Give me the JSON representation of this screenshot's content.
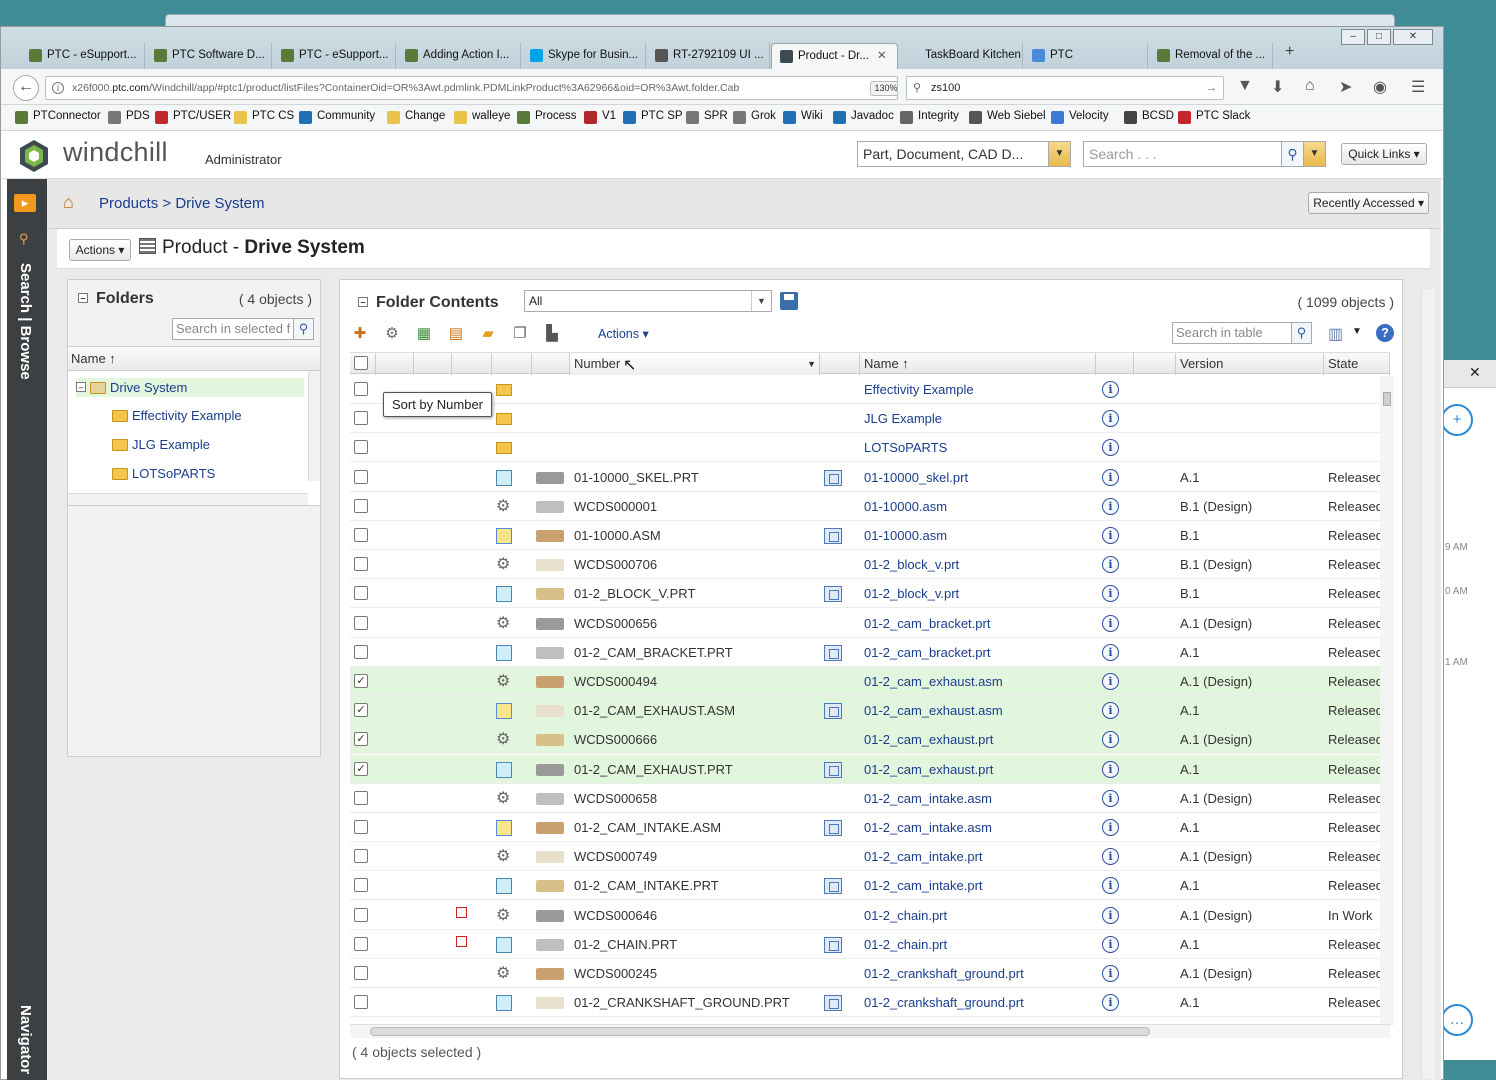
{
  "browser": {
    "tabs": [
      {
        "label": "PTC - eSupport...",
        "icon": "ptc-icon"
      },
      {
        "label": "PTC Software D...",
        "icon": "ptc-icon"
      },
      {
        "label": "PTC - eSupport...",
        "icon": "ptc-icon"
      },
      {
        "label": "Adding Action I...",
        "icon": "ptc-icon"
      },
      {
        "label": "Skype for Busin...",
        "icon": "skype-icon"
      },
      {
        "label": "RT-2792109 UI ...",
        "icon": "rt-icon"
      },
      {
        "label": "Product - Dr...",
        "icon": "windchill-icon"
      },
      {
        "label": "TaskBoard Kitchen ...",
        "icon": "none"
      },
      {
        "label": "PTC",
        "icon": "chrome-icon"
      },
      {
        "label": "Removal of the ...",
        "icon": "ptc-icon"
      }
    ],
    "new_tab": "+",
    "url_prefix": "x26f000.",
    "url_domain": "ptc.com",
    "url_rest": "/Windchill/app/#ptc1/product/listFiles?ContainerOid=OR%3Awt.pdmlink.PDMLinkProduct%3A62966&oid=OR%3Awt.folder.Cab",
    "zoom": "130%",
    "search_value": "zs100",
    "bookmarks": [
      "PTConnector",
      "PDS",
      "PTC/USER",
      "PTC CS",
      "Community",
      "Change",
      "walleye",
      "Process",
      "V1",
      "PTC SP",
      "SPR",
      "Grok",
      "Wiki",
      "Javadoc",
      "Integrity",
      "Web Siebel",
      "Velocity",
      "BCSD",
      "PTC Slack"
    ]
  },
  "header": {
    "app_name": "windchill",
    "user": "Administrator",
    "type_select": "Part, Document, CAD D...",
    "search_placeholder": "Search . . .",
    "quick_links": "Quick Links"
  },
  "left_nav": {
    "search_browse": "Search | Browse",
    "navigator": "Navigator"
  },
  "breadcrumb": {
    "products": "Products",
    "sep": ">",
    "current": "Drive System",
    "recently_accessed": "Recently Accessed"
  },
  "page": {
    "actions": "Actions",
    "title_prefix": "Product - ",
    "title_name": "Drive System"
  },
  "folders": {
    "title": "Folders",
    "count": "( 4 objects )",
    "search_placeholder": "Search in selected f",
    "col_name": "Name ↑",
    "tree": [
      {
        "label": "Drive System"
      },
      {
        "label": "Effectivity Example"
      },
      {
        "label": "JLG Example"
      },
      {
        "label": "LOTSoPARTS"
      }
    ]
  },
  "contents": {
    "title": "Folder Contents",
    "view": "All",
    "count": "( 1099 objects )",
    "actions": "Actions",
    "search_placeholder": "Search in table",
    "columns": {
      "number": "Number",
      "name": "Name ↑",
      "version": "Version",
      "state": "State"
    },
    "tooltip": "Sort by Number",
    "selected_count": "( 4 objects selected )",
    "rows": [
      {
        "type": "folder",
        "number": "",
        "name": "Effectivity Example",
        "version": "",
        "state": "",
        "checked": false
      },
      {
        "type": "folder",
        "number": "",
        "name": "JLG Example",
        "version": "",
        "state": "",
        "checked": false
      },
      {
        "type": "folder",
        "number": "",
        "name": "LOTSoPARTS",
        "version": "",
        "state": "",
        "checked": false
      },
      {
        "type": "cadpart",
        "number": "01-10000_SKEL.PRT",
        "name": "01-10000_skel.prt",
        "version": "A.1",
        "state": "Released",
        "checked": false
      },
      {
        "type": "part",
        "number": "WCDS000001",
        "name": "01-10000.asm",
        "version": "B.1 (Design)",
        "state": "Released",
        "checked": false
      },
      {
        "type": "cadasm",
        "number": "01-10000.ASM",
        "name": "01-10000.asm",
        "version": "B.1",
        "state": "Released",
        "checked": false
      },
      {
        "type": "part",
        "number": "WCDS000706",
        "name": "01-2_block_v.prt",
        "version": "B.1 (Design)",
        "state": "Released",
        "checked": false
      },
      {
        "type": "cadpart",
        "number": "01-2_BLOCK_V.PRT",
        "name": "01-2_block_v.prt",
        "version": "B.1",
        "state": "Released",
        "checked": false
      },
      {
        "type": "part",
        "number": "WCDS000656",
        "name": "01-2_cam_bracket.prt",
        "version": "A.1 (Design)",
        "state": "Released",
        "checked": false
      },
      {
        "type": "cadpart",
        "number": "01-2_CAM_BRACKET.PRT",
        "name": "01-2_cam_bracket.prt",
        "version": "A.1",
        "state": "Released",
        "checked": false
      },
      {
        "type": "part",
        "number": "WCDS000494",
        "name": "01-2_cam_exhaust.asm",
        "version": "A.1 (Design)",
        "state": "Released",
        "checked": true
      },
      {
        "type": "cadasm",
        "number": "01-2_CAM_EXHAUST.ASM",
        "name": "01-2_cam_exhaust.asm",
        "version": "A.1",
        "state": "Released",
        "checked": true
      },
      {
        "type": "part",
        "number": "WCDS000666",
        "name": "01-2_cam_exhaust.prt",
        "version": "A.1 (Design)",
        "state": "Released",
        "checked": true
      },
      {
        "type": "cadpart",
        "number": "01-2_CAM_EXHAUST.PRT",
        "name": "01-2_cam_exhaust.prt",
        "version": "A.1",
        "state": "Released",
        "checked": true
      },
      {
        "type": "part",
        "number": "WCDS000658",
        "name": "01-2_cam_intake.asm",
        "version": "A.1 (Design)",
        "state": "Released",
        "checked": false
      },
      {
        "type": "cadasm",
        "number": "01-2_CAM_INTAKE.ASM",
        "name": "01-2_cam_intake.asm",
        "version": "A.1",
        "state": "Released",
        "checked": false
      },
      {
        "type": "part",
        "number": "WCDS000749",
        "name": "01-2_cam_intake.prt",
        "version": "A.1 (Design)",
        "state": "Released",
        "checked": false
      },
      {
        "type": "cadpart",
        "number": "01-2_CAM_INTAKE.PRT",
        "name": "01-2_cam_intake.prt",
        "version": "A.1",
        "state": "Released",
        "checked": false
      },
      {
        "type": "part",
        "number": "WCDS000646",
        "name": "01-2_chain.prt",
        "version": "A.1 (Design)",
        "state": "In Work",
        "checked": false
      },
      {
        "type": "cadpart",
        "number": "01-2_CHAIN.PRT",
        "name": "01-2_chain.prt",
        "version": "A.1",
        "state": "Released",
        "checked": false
      },
      {
        "type": "part",
        "number": "WCDS000245",
        "name": "01-2_crankshaft_ground.prt",
        "version": "A.1 (Design)",
        "state": "Released",
        "checked": false
      },
      {
        "type": "cadpart",
        "number": "01-2_CRANKSHAFT_GROUND.PRT",
        "name": "01-2_crankshaft_ground.prt",
        "version": "A.1",
        "state": "Released",
        "checked": false
      }
    ]
  },
  "side_panel": {
    "times": [
      "9 AM",
      "0 AM",
      "1 AM"
    ]
  }
}
